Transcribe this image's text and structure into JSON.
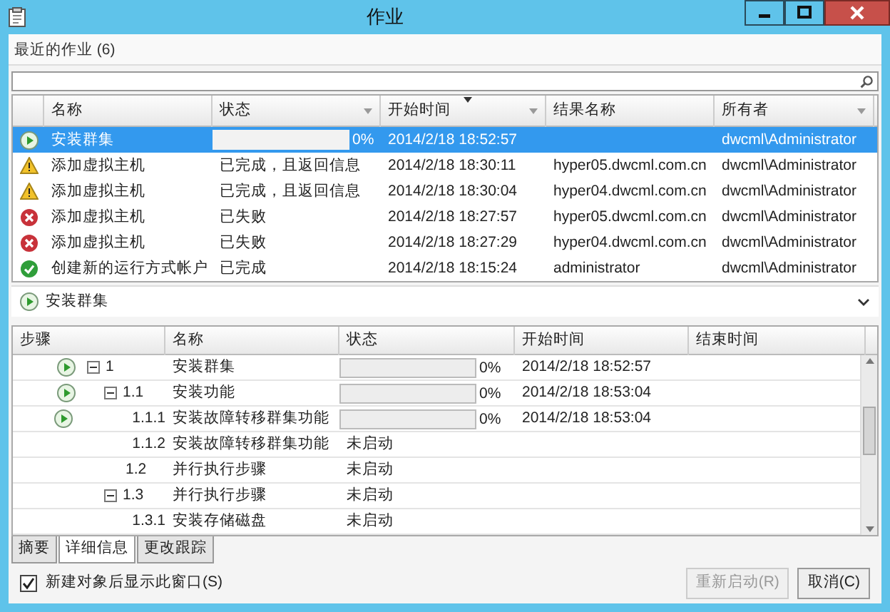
{
  "window": {
    "title": "作业"
  },
  "recent_jobs": {
    "title": "最近的作业 (6)"
  },
  "jobs_table": {
    "columns": [
      {
        "label": "名称",
        "sorted": false,
        "filter": false
      },
      {
        "label": "状态",
        "sorted": false,
        "filter": true
      },
      {
        "label": "开始时间",
        "sorted": true,
        "filter": true
      },
      {
        "label": "结果名称",
        "sorted": false,
        "filter": false
      },
      {
        "label": "所有者",
        "sorted": false,
        "filter": true
      }
    ],
    "rows": [
      {
        "kind": "running",
        "name": "安装群集",
        "progress": {
          "level": 0,
          "reading": "0%"
        },
        "start": "2014/2/18 18:52:57",
        "owner": "dwcml\\Administrator",
        "selected": true
      },
      {
        "kind": "warning",
        "name": "添加虚拟主机",
        "state": "已完成，且返回信息",
        "start": "2014/2/18 18:30:11",
        "result": "hyper05.dwcml.com.cn",
        "owner": "dwcml\\Administrator",
        "selected": false
      },
      {
        "kind": "warning",
        "name": "添加虚拟主机",
        "state": "已完成，且返回信息",
        "start": "2014/2/18 18:30:04",
        "result": "hyper04.dwcml.com.cn",
        "owner": "dwcml\\Administrator",
        "selected": false
      },
      {
        "kind": "failed",
        "name": "添加虚拟主机",
        "state": "已失败",
        "start": "2014/2/18 18:27:57",
        "result": "hyper05.dwcml.com.cn",
        "owner": "dwcml\\Administrator",
        "selected": false
      },
      {
        "kind": "failed",
        "name": "添加虚拟主机",
        "state": "已失败",
        "start": "2014/2/18 18:27:29",
        "result": "hyper04.dwcml.com.cn",
        "owner": "dwcml\\Administrator",
        "selected": false
      },
      {
        "kind": "completed",
        "name": "创建新的运行方式帐户",
        "state": "已完成",
        "start": "2014/2/18 18:15:24",
        "result": "administrator",
        "owner": "dwcml\\Administrator",
        "selected": false
      }
    ]
  },
  "current_job": {
    "kind": "running",
    "name": "安装群集",
    "expanded": false
  },
  "steps_table": {
    "columns": [
      "步骤",
      "名称",
      "状态",
      "开始时间",
      "结束时间"
    ],
    "rows": [
      {
        "step": "1",
        "name": "安装群集",
        "kind": "running",
        "progress": {
          "level": 0,
          "reading": "0%"
        },
        "start": "2014/2/18 18:52:57",
        "expanded": true,
        "children": [
          {
            "step": "1.1",
            "name": "安装功能",
            "kind": "running",
            "progress": {
              "level": 0,
              "reading": "0%"
            },
            "start": "2014/2/18 18:53:04",
            "expanded": true,
            "children": [
              {
                "step": "1.1.1",
                "name": "安装故障转移群集功能",
                "kind": "running",
                "progress": {
                  "level": 0,
                  "reading": "0%"
                },
                "start": "2014/2/18 18:53:04"
              },
              {
                "step": "1.1.2",
                "name": "安装故障转移群集功能",
                "kind": "not_started",
                "state": "未启动"
              }
            ]
          },
          {
            "step": "1.2",
            "name": "并行执行步骤",
            "kind": "not_started",
            "state": "未启动"
          },
          {
            "step": "1.3",
            "name": "并行执行步骤",
            "kind": "not_started",
            "state": "未启动",
            "expanded": true,
            "children": [
              {
                "step": "1.3.1",
                "name": "安装存储磁盘",
                "kind": "not_started",
                "state": "未启动"
              }
            ]
          }
        ]
      }
    ]
  },
  "tabs": [
    {
      "label": "摘要",
      "selected": false
    },
    {
      "label": "详细信息",
      "selected": true
    },
    {
      "label": "更改跟踪",
      "selected": false
    }
  ],
  "show_window_checkbox": {
    "label": "新建对象后显示此窗口(S)",
    "checked": true
  },
  "buttons": [
    {
      "label": "重新启动(R)",
      "disabled": true
    },
    {
      "label": "取消(C)",
      "disabled": false
    }
  ]
}
